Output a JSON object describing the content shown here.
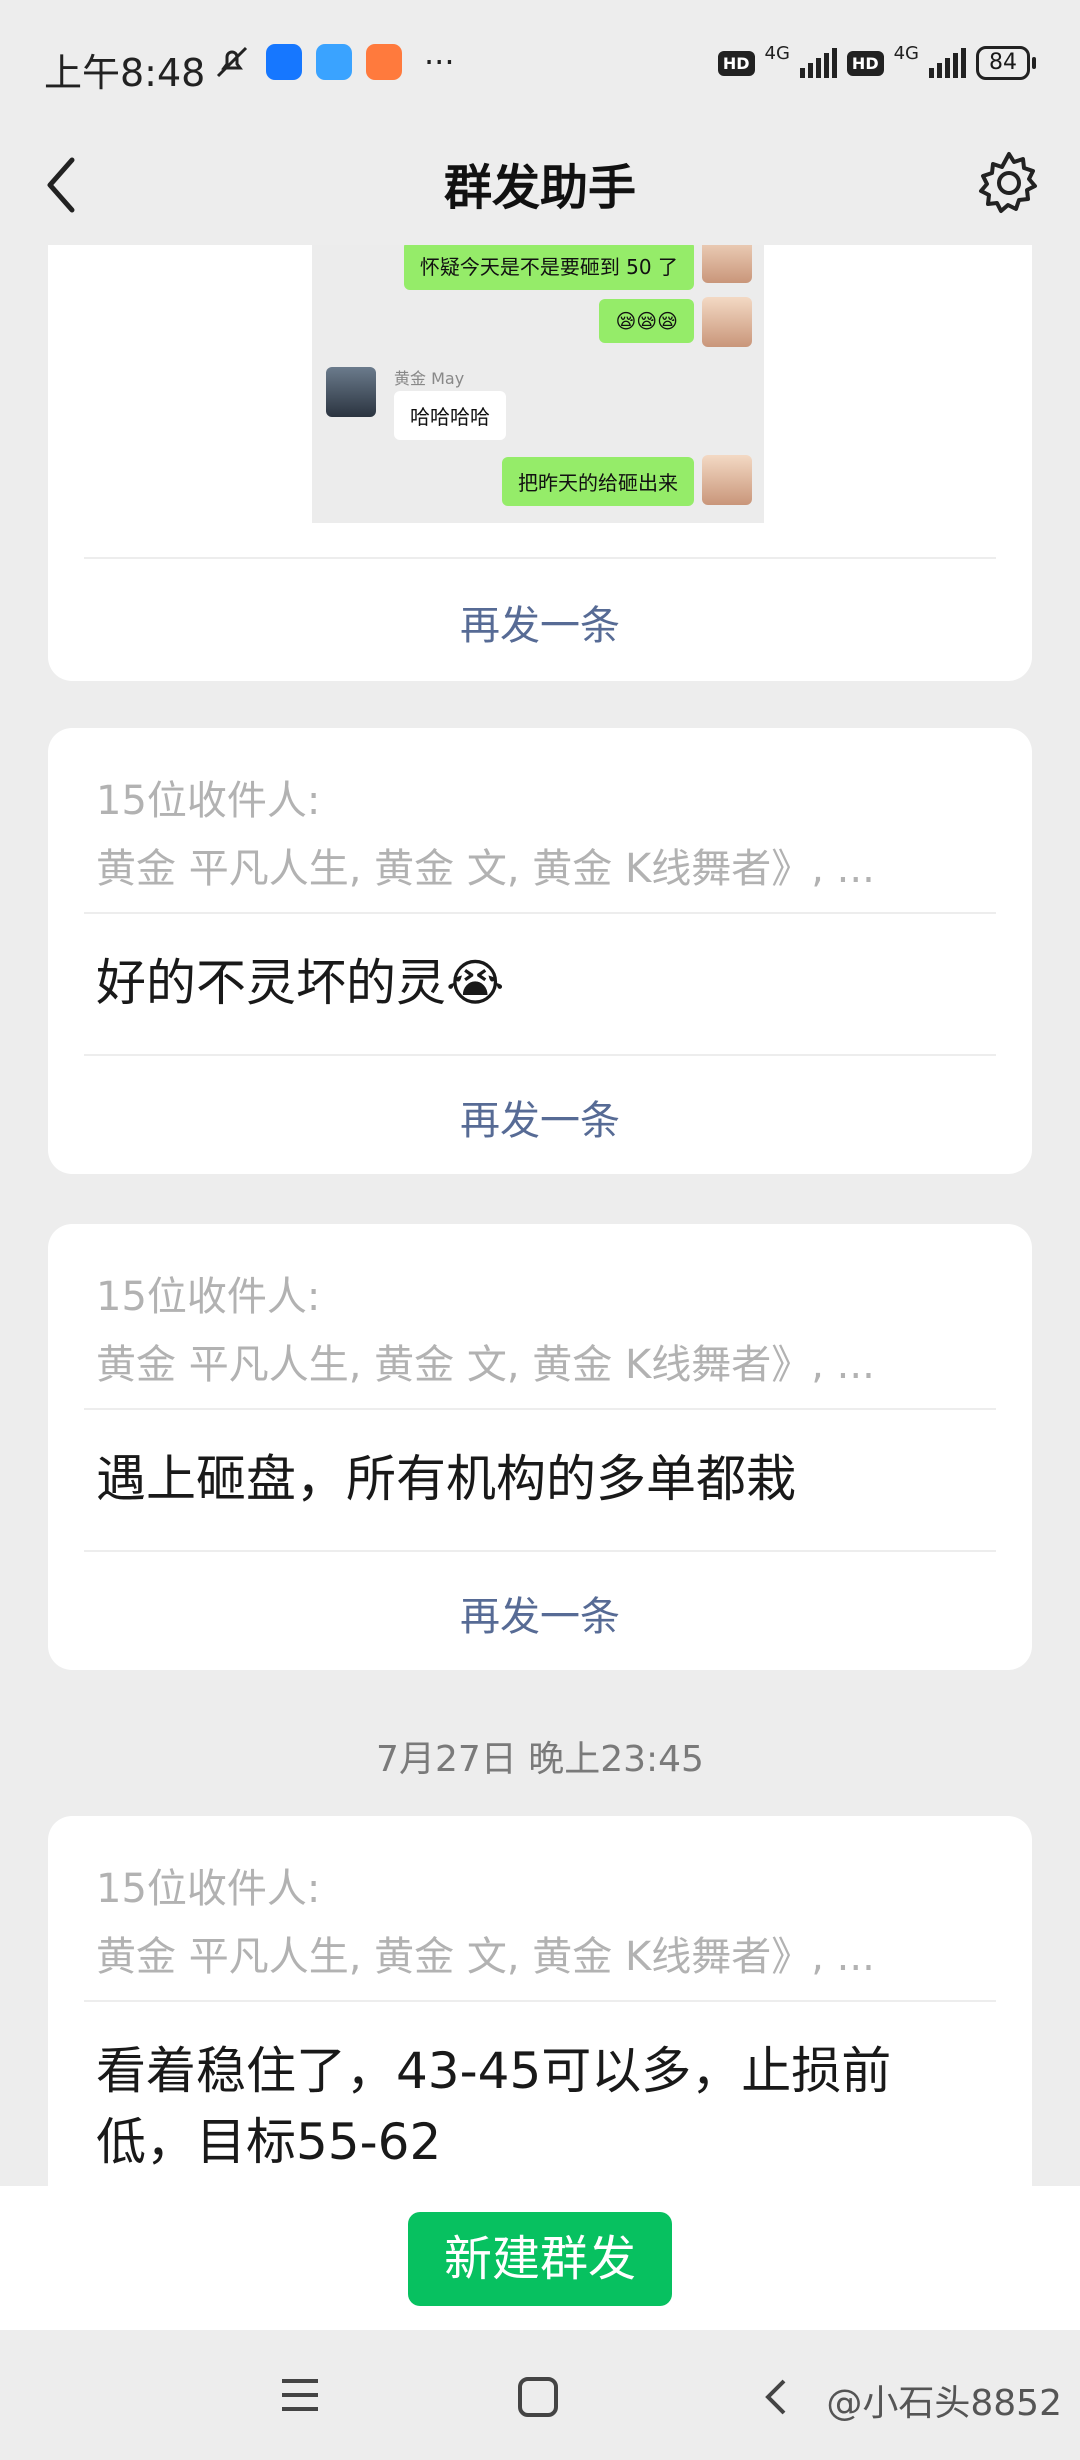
{
  "status": {
    "time": "上午8:48",
    "net1": "4G",
    "net2": "4G",
    "hd": "HD",
    "battery": "84"
  },
  "header": {
    "title": "群发助手"
  },
  "chat_shot": {
    "m1": "怀疑今天是不是要砸到 50 了",
    "m2": "😪😪😪",
    "sender": "黄金   May",
    "m3": "哈哈哈哈",
    "m4": "把昨天的给砸出来"
  },
  "card1": {
    "resend": "再发一条"
  },
  "card2": {
    "recipients_head": "15位收件人:",
    "recipients_names": "黄金   平凡人生, 黄金   文, 黄金   K线舞者》, ...",
    "message": "好的不灵坏的灵😭",
    "resend": "再发一条"
  },
  "card3": {
    "recipients_head": "15位收件人:",
    "recipients_names": "黄金   平凡人生, 黄金   文, 黄金   K线舞者》, ...",
    "message": "遇上砸盘，所有机构的多单都栽",
    "resend": "再发一条"
  },
  "date_label": "7月27日 晚上23:45",
  "card4": {
    "recipients_head": "15位收件人:",
    "recipients_names": "黄金   平凡人生, 黄金   文, 黄金   K线舞者》, ...",
    "message": "看着稳住了，43-45可以多，止损前低，目标55-62"
  },
  "bottom": {
    "new_button": "新建群发"
  },
  "watermark": "@小石头8852",
  "colors": {
    "accent": "#07c160",
    "link": "#576b95",
    "bg": "#ededed"
  }
}
